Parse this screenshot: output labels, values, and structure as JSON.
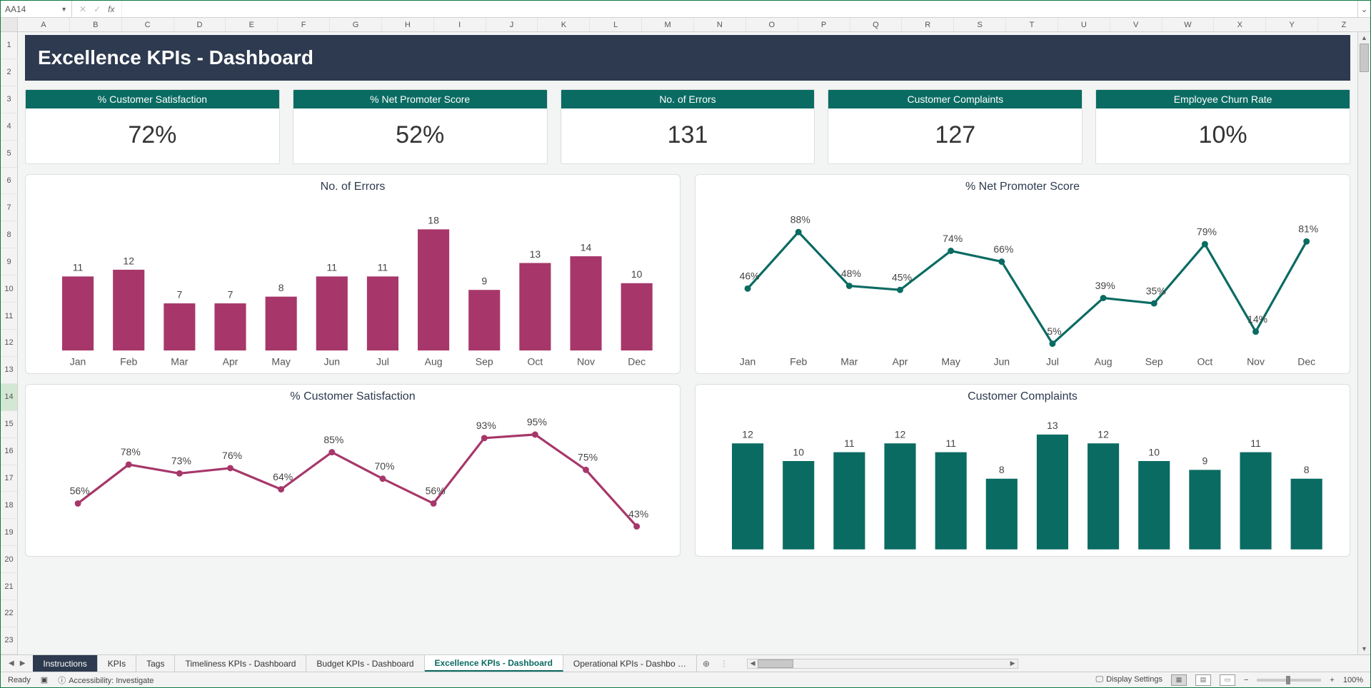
{
  "formula_bar": {
    "name_box": "AA14",
    "fx_label": "fx",
    "value": ""
  },
  "columns": [
    "A",
    "B",
    "C",
    "D",
    "E",
    "F",
    "G",
    "H",
    "I",
    "J",
    "K",
    "L",
    "M",
    "N",
    "O",
    "P",
    "Q",
    "R",
    "S",
    "T",
    "U",
    "V",
    "W",
    "X",
    "Y",
    "Z"
  ],
  "rows": [
    "1",
    "2",
    "3",
    "4",
    "5",
    "6",
    "7",
    "8",
    "9",
    "10",
    "11",
    "12",
    "13",
    "14",
    "15",
    "16",
    "17",
    "18",
    "19",
    "20",
    "21",
    "22",
    "23"
  ],
  "selected_row_index": 13,
  "banner_title": "Excellence KPIs - Dashboard",
  "kpis": [
    {
      "label": "% Customer Satisfaction",
      "value": "72%"
    },
    {
      "label": "% Net Promoter Score",
      "value": "52%"
    },
    {
      "label": "No. of Errors",
      "value": "131"
    },
    {
      "label": "Customer Complaints",
      "value": "127"
    },
    {
      "label": "Employee Churn Rate",
      "value": "10%"
    }
  ],
  "tabs": {
    "items": [
      {
        "label": "Instructions",
        "style": "dark"
      },
      {
        "label": "KPIs"
      },
      {
        "label": "Tags"
      },
      {
        "label": "Timeliness KPIs - Dashboard"
      },
      {
        "label": "Budget KPIs - Dashboard"
      },
      {
        "label": "Excellence KPIs - Dashboard",
        "active": true
      },
      {
        "label": "Operational KPIs - Dashbo …"
      }
    ],
    "add_label": "⊕"
  },
  "status_bar": {
    "ready": "Ready",
    "accessibility": "Accessibility: Investigate",
    "display_settings": "Display Settings",
    "zoom": "100%"
  },
  "chart_data": [
    {
      "id": "errors",
      "type": "bar",
      "title": "No. of Errors",
      "categories": [
        "Jan",
        "Feb",
        "Mar",
        "Apr",
        "May",
        "Jun",
        "Jul",
        "Aug",
        "Sep",
        "Oct",
        "Nov",
        "Dec"
      ],
      "values": [
        11,
        12,
        7,
        7,
        8,
        11,
        11,
        18,
        9,
        13,
        14,
        10
      ],
      "color": "#a7376a",
      "label_suffix": "",
      "ylim": [
        0,
        20
      ]
    },
    {
      "id": "nps",
      "type": "line",
      "title": "% Net Promoter Score",
      "categories": [
        "Jan",
        "Feb",
        "Mar",
        "Apr",
        "May",
        "Jun",
        "Jul",
        "Aug",
        "Sep",
        "Oct",
        "Nov",
        "Dec"
      ],
      "values": [
        46,
        88,
        48,
        45,
        74,
        66,
        5,
        39,
        35,
        79,
        14,
        81
      ],
      "color": "#0a6b62",
      "label_suffix": "%",
      "ylim": [
        0,
        100
      ]
    },
    {
      "id": "csat",
      "type": "line",
      "title": "% Customer Satisfaction",
      "categories": [
        "Jan",
        "Feb",
        "Mar",
        "Apr",
        "May",
        "Jun",
        "Jul",
        "Aug",
        "Sep",
        "Oct",
        "Nov",
        "Dec"
      ],
      "values": [
        56,
        78,
        73,
        76,
        64,
        85,
        70,
        56,
        93,
        95,
        75,
        43
      ],
      "color": "#a7376a",
      "label_suffix": "%",
      "ylim": [
        30,
        100
      ]
    },
    {
      "id": "complaints",
      "type": "bar",
      "title": "Customer Complaints",
      "categories": [
        "Jan",
        "Feb",
        "Mar",
        "Apr",
        "May",
        "Jun",
        "Jul",
        "Aug",
        "Sep",
        "Oct",
        "Nov",
        "Dec"
      ],
      "values": [
        12,
        10,
        11,
        12,
        11,
        8,
        13,
        12,
        10,
        9,
        11,
        8
      ],
      "color": "#0a6b62",
      "label_suffix": "",
      "ylim": [
        0,
        14
      ]
    }
  ]
}
